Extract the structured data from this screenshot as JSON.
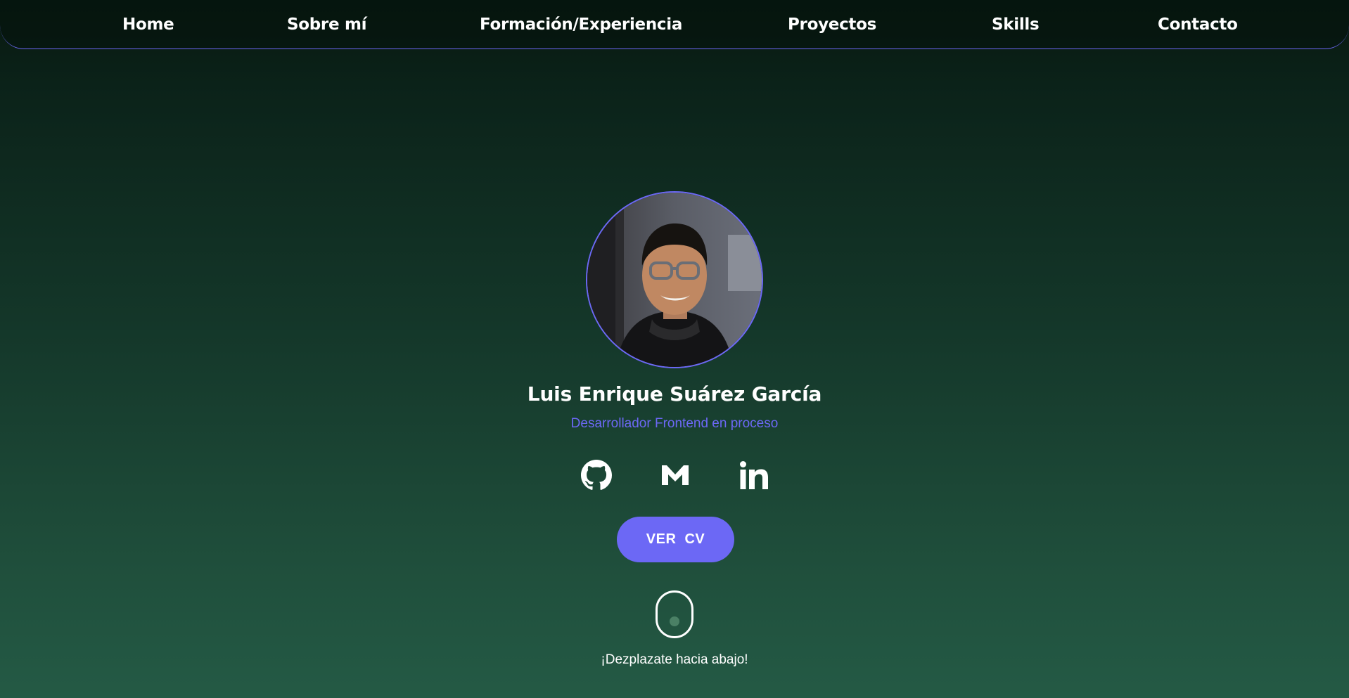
{
  "nav": {
    "items": [
      {
        "label": "Home"
      },
      {
        "label": "Sobre mí"
      },
      {
        "label": "Formación/Experiencia"
      },
      {
        "label": "Proyectos"
      },
      {
        "label": "Skills"
      },
      {
        "label": "Contacto"
      }
    ],
    "border_color": "#6c68f5"
  },
  "hero": {
    "name": "Luis Enrique Suárez García",
    "role": "Desarrollador Frontend en proceso",
    "social_icons": [
      "github-icon",
      "gmail-icon",
      "linkedin-icon"
    ],
    "cv_button_label": "VER  CV",
    "scroll_hint": "¡Dezplazate hacia abajo!"
  },
  "colors": {
    "accent": "#6c68f5",
    "background_top": "#08180f",
    "background_bottom": "#245a45",
    "text": "#ffffff"
  }
}
